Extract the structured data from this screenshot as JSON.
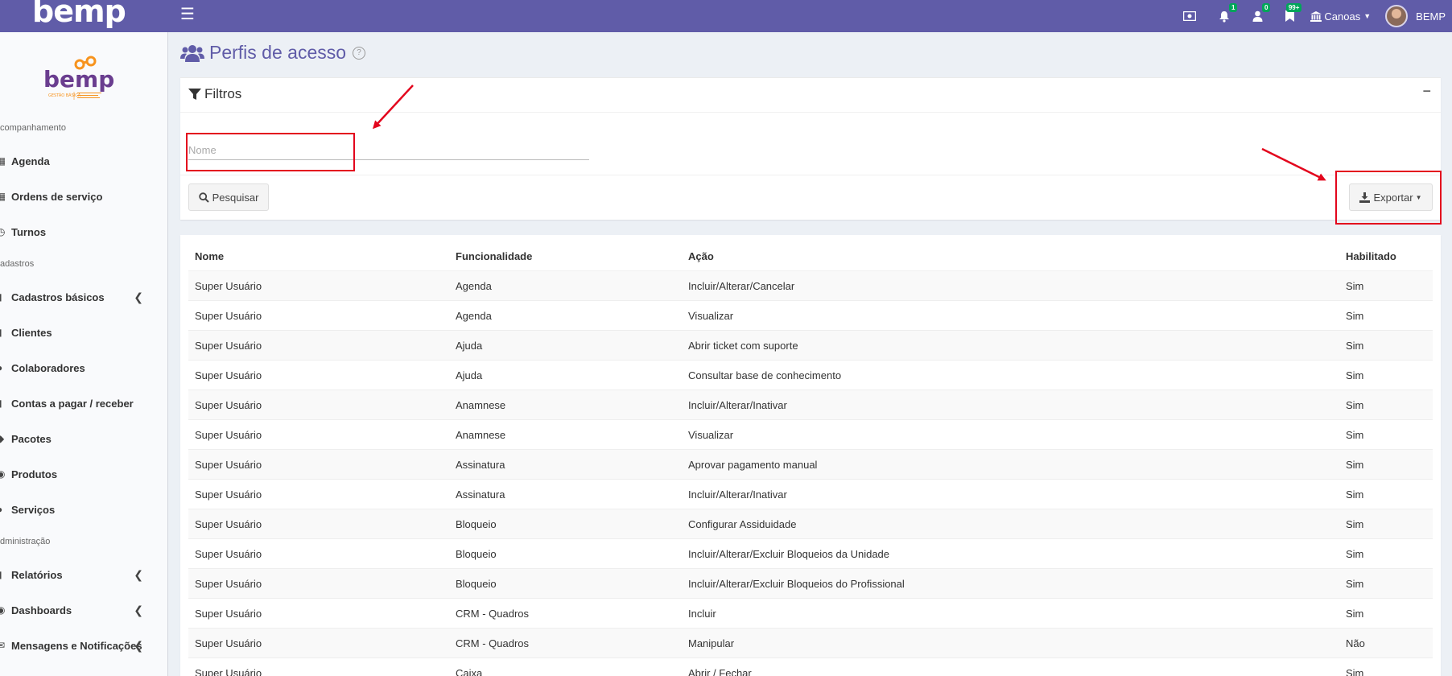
{
  "app": {
    "logo_text": "bemp",
    "unit_label": "Canoas",
    "user_name": "BEMP",
    "badges": {
      "notifications": "1",
      "users": "0",
      "bookmarks": "99+"
    },
    "brand_color": "#605ca8",
    "badge_color": "#00a65a",
    "annotation_color": "#e3061d"
  },
  "sidebar": {
    "logo_text": "bemp",
    "logo_tagline": "GESTÃO BÁSICA",
    "sections": [
      {
        "title": "companhamento"
      },
      {
        "title": "adastros"
      },
      {
        "title": "dministração"
      }
    ],
    "items": [
      {
        "label": "Agenda",
        "icon": "calendar-icon"
      },
      {
        "label": "Ordens de serviço",
        "icon": "id-card-icon"
      },
      {
        "label": "Turnos",
        "icon": "clock-icon"
      },
      {
        "label": "Cadastros básicos",
        "icon": "book-icon"
      },
      {
        "label": "Clientes",
        "icon": "bookmark-icon"
      },
      {
        "label": "Colaboradores",
        "icon": "user-icon"
      },
      {
        "label": "Contas a pagar / receber",
        "icon": "file-icon"
      },
      {
        "label": "Pacotes",
        "icon": "dropbox-icon"
      },
      {
        "label": "Produtos",
        "icon": "cube-icon"
      },
      {
        "label": "Serviços",
        "icon": "user-cog-icon"
      },
      {
        "label": "Relatórios",
        "icon": "book-icon"
      },
      {
        "label": "Dashboards",
        "icon": "tachometer-icon"
      },
      {
        "label": "Mensagens e Notificações",
        "icon": "envelope-icon"
      }
    ]
  },
  "page": {
    "title": "Perfis de acesso",
    "help_icon": "?"
  },
  "filters": {
    "title": "Filtros",
    "collapse_symbol": "−",
    "name_placeholder": "Nome",
    "name_value": "",
    "search_label": "Pesquisar",
    "export_label": "Exportar"
  },
  "table": {
    "headers": [
      "Nome",
      "Funcionalidade",
      "Ação",
      "Habilitado"
    ],
    "rows": [
      [
        "Super Usuário",
        "Agenda",
        "Incluir/Alterar/Cancelar",
        "Sim"
      ],
      [
        "Super Usuário",
        "Agenda",
        "Visualizar",
        "Sim"
      ],
      [
        "Super Usuário",
        "Ajuda",
        "Abrir ticket com suporte",
        "Sim"
      ],
      [
        "Super Usuário",
        "Ajuda",
        "Consultar base de conhecimento",
        "Sim"
      ],
      [
        "Super Usuário",
        "Anamnese",
        "Incluir/Alterar/Inativar",
        "Sim"
      ],
      [
        "Super Usuário",
        "Anamnese",
        "Visualizar",
        "Sim"
      ],
      [
        "Super Usuário",
        "Assinatura",
        "Aprovar pagamento manual",
        "Sim"
      ],
      [
        "Super Usuário",
        "Assinatura",
        "Incluir/Alterar/Inativar",
        "Sim"
      ],
      [
        "Super Usuário",
        "Bloqueio",
        "Configurar Assiduidade",
        "Sim"
      ],
      [
        "Super Usuário",
        "Bloqueio",
        "Incluir/Alterar/Excluir Bloqueios da Unidade",
        "Sim"
      ],
      [
        "Super Usuário",
        "Bloqueio",
        "Incluir/Alterar/Excluir Bloqueios do Profissional",
        "Sim"
      ],
      [
        "Super Usuário",
        "CRM - Quadros",
        "Incluir",
        "Sim"
      ],
      [
        "Super Usuário",
        "CRM - Quadros",
        "Manipular",
        "Não"
      ],
      [
        "Super Usuário",
        "Caixa",
        "Abrir / Fechar",
        "Sim"
      ]
    ]
  }
}
